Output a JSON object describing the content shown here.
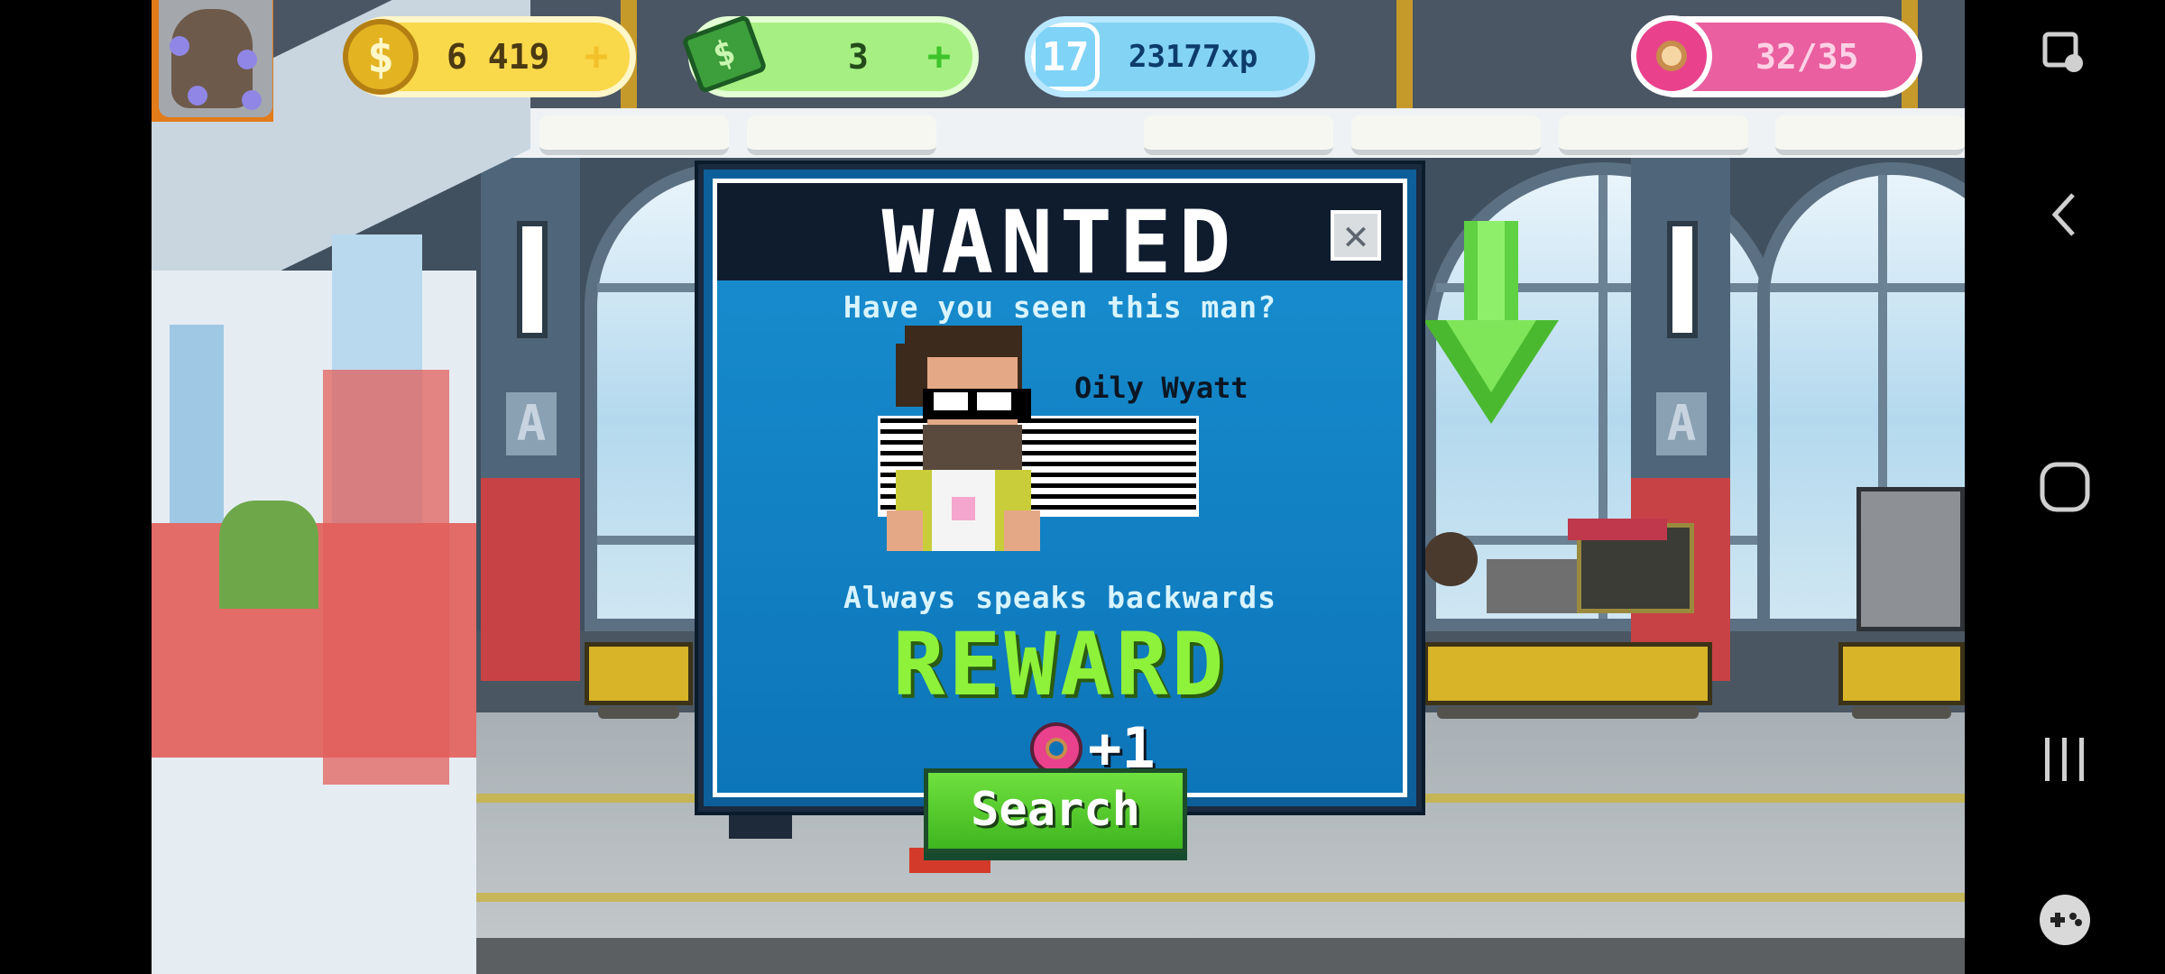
{
  "hud": {
    "coins": "6 419",
    "cash": "3",
    "level": "17",
    "xp": "23177xp",
    "donuts": "32/35",
    "xp_progress": 0.12
  },
  "modal": {
    "title": "WANTED",
    "question": "Have you seen this man?",
    "suspect_name": "Oily Wyatt",
    "description": "Always speaks backwards",
    "reward_label": "REWARD",
    "reward_value": "+1",
    "search_label": "Search",
    "close_symbol": "✕"
  },
  "icons": {
    "coin": "coin-icon",
    "cash": "cash-icon",
    "level": "level-badge-icon",
    "donut": "donut-icon",
    "avatar": "avatar-icon"
  },
  "nav": [
    "screenshot-icon",
    "back-icon",
    "home-icon",
    "recent-apps-icon",
    "game-tools-icon"
  ],
  "colors": {
    "coin_pill": "#f9d84a",
    "cash_pill": "#8fe36b",
    "xp_pill": "#33b6ea",
    "donut_pill": "#ea5fa0",
    "modal_bg": "#0c5f99",
    "reward": "#8ef23a",
    "search_button": "#4fc72a"
  }
}
